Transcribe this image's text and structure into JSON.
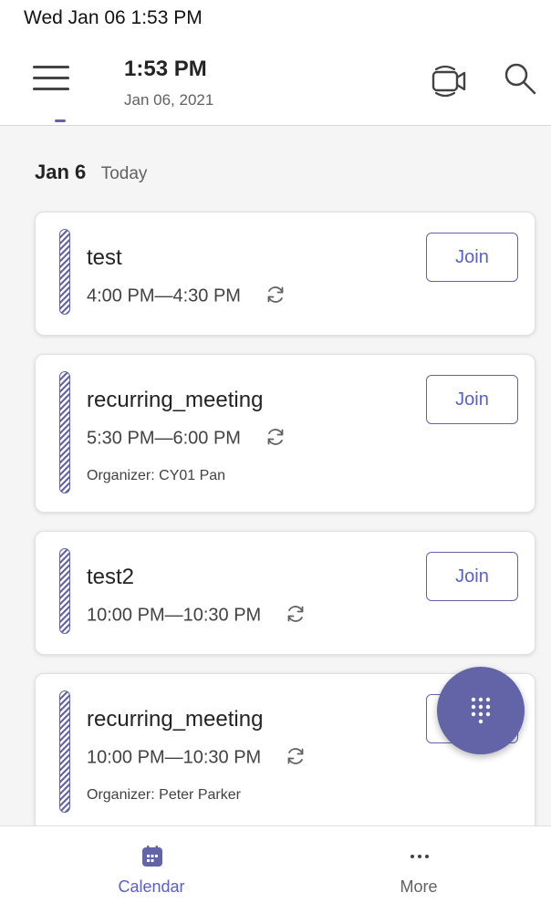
{
  "status_bar": {
    "time": "Wed Jan 06  1:53 PM"
  },
  "header": {
    "title": "1:53 PM",
    "subtitle": "Jan 06, 2021",
    "menu_icon": "hamburger-menu-icon",
    "meet_now_icon": "video-camera-icon",
    "search_icon": "search-icon"
  },
  "day": {
    "date": "Jan 6",
    "label": "Today"
  },
  "meetings": [
    {
      "title": "test",
      "time": "4:00 PM—4:30 PM",
      "organizer": "",
      "join_label": "Join"
    },
    {
      "title": "recurring_meeting",
      "time": "5:30 PM—6:00 PM",
      "organizer": "Organizer: CY01 Pan",
      "join_label": "Join"
    },
    {
      "title": "test2",
      "time": "10:00 PM—10:30 PM",
      "organizer": "",
      "join_label": "Join"
    },
    {
      "title": "recurring_meeting",
      "time": "10:00 PM—10:30 PM",
      "organizer": "Organizer: Peter Parker",
      "join_label": "Join"
    }
  ],
  "fab": {
    "icon": "dialpad-icon"
  },
  "bottom_nav": [
    {
      "label": "Calendar",
      "icon": "calendar-icon",
      "active": true
    },
    {
      "label": "More",
      "icon": "more-dots-icon",
      "active": false
    }
  ],
  "colors": {
    "accent": "#6264a7",
    "accent_text": "#5b5fc7",
    "background": "#f5f5f5"
  }
}
